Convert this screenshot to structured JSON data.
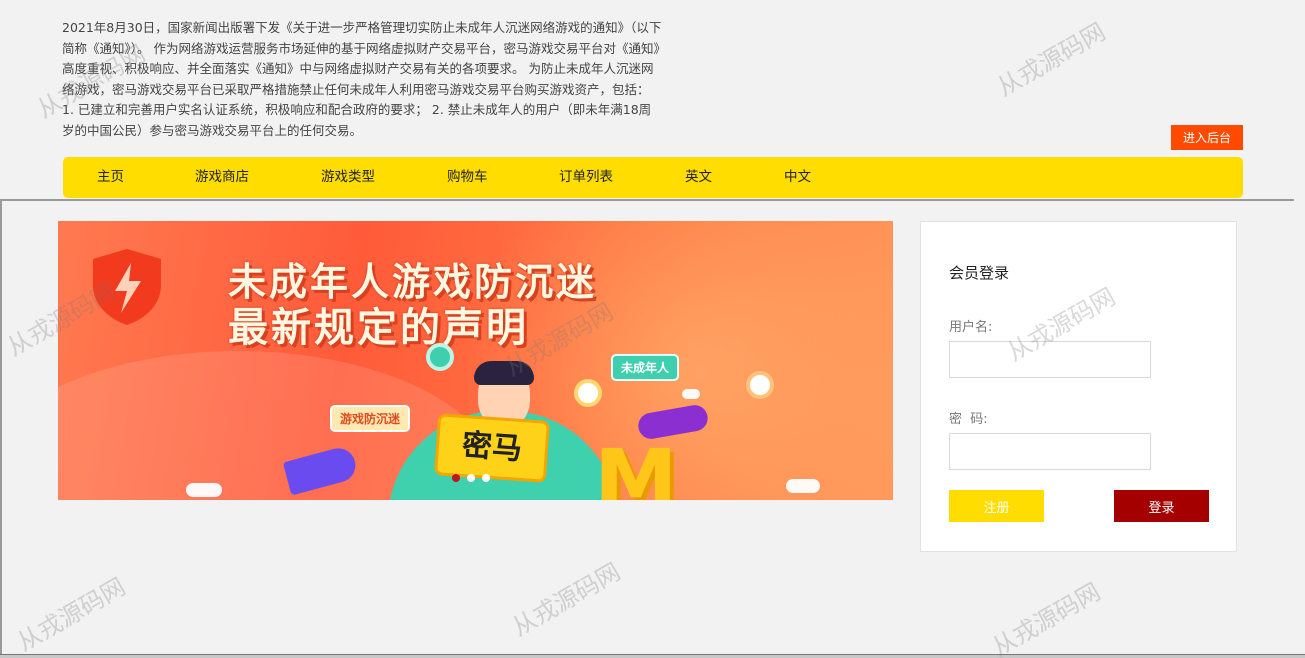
{
  "notice": {
    "text": "2021年8月30日，国家新闻出版署下发《关于进一步严格管理切实防止未成年人沉迷网络游戏的通知》（以下简称《通知》）。 作为网络游戏运营服务市场延伸的基于网络虚拟财产交易平台，密马游戏交易平台对《通知》高度重视、积极响应、并全面落实《通知》中与网络虚拟财产交易有关的各项要求。 为防止未成年人沉迷网络游戏，密马游戏交易平台已采取严格措施禁止任何未成年人利用密马游戏交易平台购买游戏资产，包括： 1. 已建立和完善用户实名认证系统，积极响应和配合政府的要求； 2. 禁止未成年人的用户（即未年满18周岁的中国公民）参与密马游戏交易平台上的任何交易。"
  },
  "header": {
    "admin_button": "进入后台"
  },
  "nav": {
    "items": [
      "主页",
      "游戏商店",
      "游戏类型",
      "购物车",
      "订单列表",
      "英文",
      "中文"
    ]
  },
  "banner": {
    "title_line1": "未成年人游戏防沉迷",
    "title_line2": "最新规定的声明",
    "tag_game": "游戏防沉迷",
    "tag_minor": "未成年人",
    "sign_text": "密马",
    "logo_letter": "M",
    "slides": 3,
    "active_slide": 0,
    "accent_color": "#ff5b3a"
  },
  "login": {
    "title": "会员登录",
    "username_label": "用户名:",
    "username_value": "",
    "password_label": "密  码:",
    "password_value": "",
    "register_button": "注册",
    "login_button": "登录"
  },
  "watermark": {
    "text": "从戎源码网"
  },
  "colors": {
    "nav_bg": "#ffdd00",
    "admin_btn": "#ff4a00",
    "register_btn": "#ffdd00",
    "login_btn": "#a50000"
  }
}
